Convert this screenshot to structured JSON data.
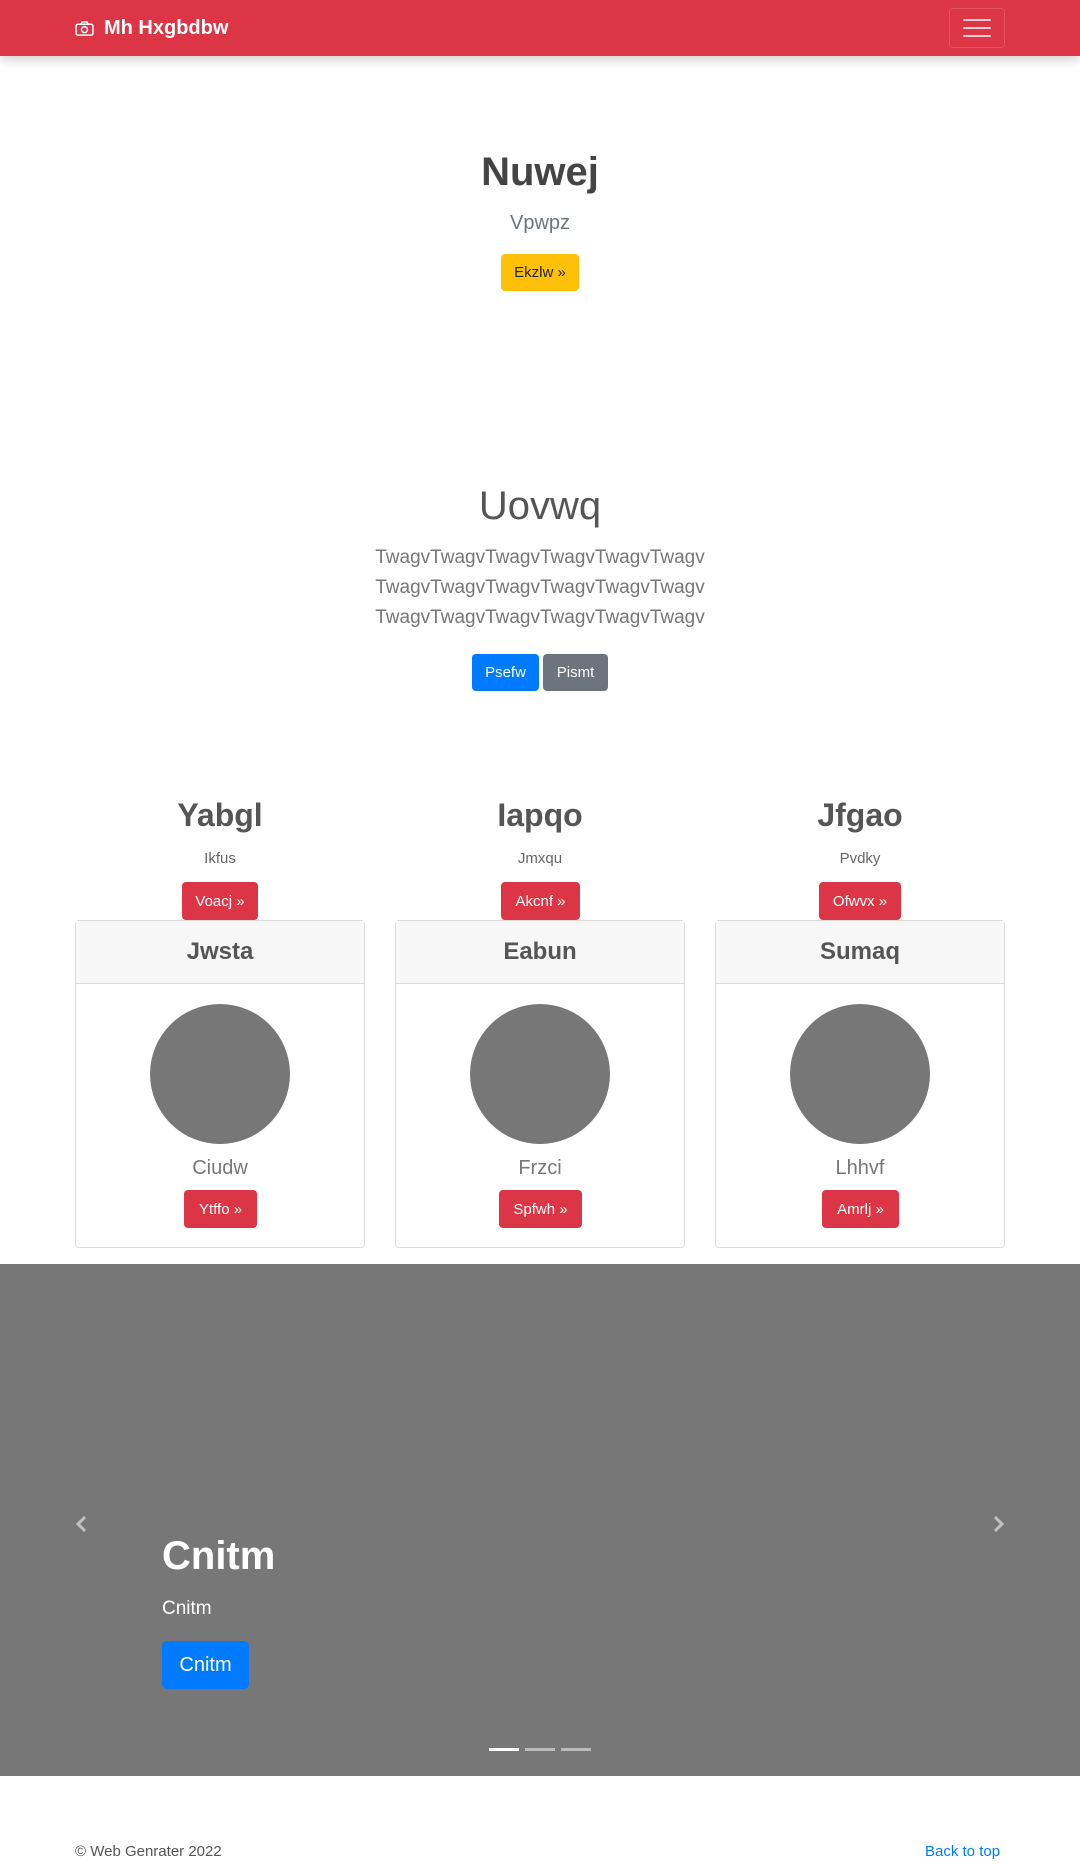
{
  "navbar": {
    "brand": "Mh Hxgbdbw",
    "brand_icon": "camera-icon",
    "toggler_icon": "hamburger-icon",
    "color": "#dc3545"
  },
  "hero": {
    "title": "Nuwej",
    "subtitle": "Vpwpz",
    "button": "Ekzlw »"
  },
  "section2": {
    "title": "Uovwq",
    "text": "TwagvTwagvTwagvTwagvTwagvTwagv TwagvTwagvTwagvTwagvTwagvTwagv TwagvTwagvTwagvTwagvTwagvTwagv",
    "primary_button": "Psefw",
    "secondary_button": "Pismt"
  },
  "columns": [
    {
      "title": "Yabgl",
      "subtitle": "Ikfus",
      "button": "Voacj »"
    },
    {
      "title": "Iapqo",
      "subtitle": "Jmxqu",
      "button": "Akcnf »"
    },
    {
      "title": "Jfgao",
      "subtitle": "Pvdky",
      "button": "Ofwvx »"
    }
  ],
  "cards": [
    {
      "header": "Jwsta",
      "name": "Ciudw",
      "button": "Ytffo »"
    },
    {
      "header": "Eabun",
      "name": "Frzci",
      "button": "Spfwh »"
    },
    {
      "header": "Sumaq",
      "name": "Lhhvf",
      "button": "Amrlj »"
    }
  ],
  "carousel": {
    "title": "Cnitm",
    "subtitle": "Cnitm",
    "button": "Cnitm",
    "prev_icon": "chevron-left-icon",
    "next_icon": "chevron-right-icon",
    "slide_count": 3,
    "active_slide": 1
  },
  "footer": {
    "copyright": "© Web Genrater 2022",
    "back_to_top": "Back to top"
  }
}
